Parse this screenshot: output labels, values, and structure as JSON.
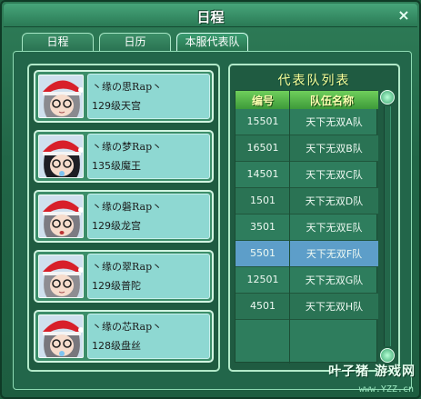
{
  "window": {
    "title": "日程",
    "close_symbol": "×"
  },
  "tabs": [
    {
      "label": "日程",
      "active": false
    },
    {
      "label": "日历",
      "active": false
    },
    {
      "label": "本服代表队",
      "active": true
    }
  ],
  "members": [
    {
      "name": "丶缘の思Rap丶",
      "detail": "129级天宫"
    },
    {
      "name": "丶缘の梦Rap丶",
      "detail": "135级魔王"
    },
    {
      "name": "丶缘の磐Rap丶",
      "detail": "129级龙宫"
    },
    {
      "name": "丶缘の翠Rap丶",
      "detail": "129级普陀"
    },
    {
      "name": "丶缘の芯Rap丶",
      "detail": "128级盘丝"
    }
  ],
  "team_list": {
    "title": "代表队列表",
    "headers": {
      "id": "编号",
      "name": "队伍名称"
    },
    "rows": [
      {
        "id": "15501",
        "name": "天下无双A队",
        "selected": false
      },
      {
        "id": "16501",
        "name": "天下无双B队",
        "selected": false
      },
      {
        "id": "14501",
        "name": "天下无双C队",
        "selected": false
      },
      {
        "id": "1501",
        "name": "天下无双D队",
        "selected": false
      },
      {
        "id": "3501",
        "name": "天下无双E队",
        "selected": false
      },
      {
        "id": "5501",
        "name": "天下无双F队",
        "selected": true
      },
      {
        "id": "12501",
        "name": "天下无双G队",
        "selected": false
      },
      {
        "id": "4501",
        "name": "天下无双H队",
        "selected": false
      }
    ]
  },
  "watermark": {
    "logo": "叶子猪 游戏网",
    "url": "www.YZZ.cn"
  },
  "colors": {
    "selected_row": "#5d9ec9",
    "header_text": "#fbffb0",
    "title_text": "#f8ff9a"
  }
}
